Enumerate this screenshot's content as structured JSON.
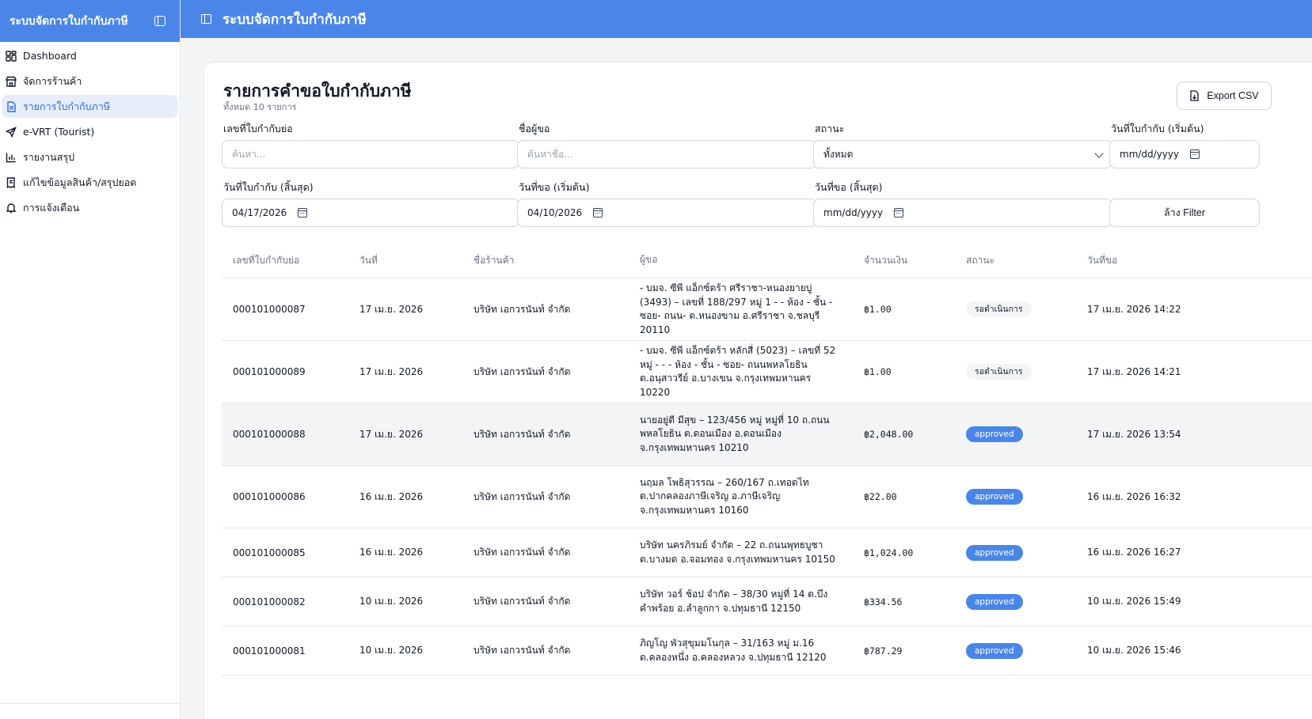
{
  "sidebar": {
    "title": "ระบบจัดการใบกำกับภาษี",
    "items": [
      {
        "label": "Dashboard",
        "icon": "dashboard-icon"
      },
      {
        "label": "จัดการร้านค้า",
        "icon": "store-icon"
      },
      {
        "label": "รายการใบกำกับภาษี",
        "icon": "document-icon",
        "active": true
      },
      {
        "label": "e-VRT (Tourist)",
        "icon": "plane-icon"
      },
      {
        "label": "รายงานสรุป",
        "icon": "bar-chart-icon"
      },
      {
        "label": "แก้ไขข้อมูลสินค้า/สรุปยอด",
        "icon": "receipt-edit-icon"
      },
      {
        "label": "การแจ้งเตือน",
        "icon": "bell-icon"
      }
    ]
  },
  "header": {
    "title": "ระบบจัดการใบกำกับภาษี"
  },
  "page": {
    "title": "รายการคำขอใบกำกับภาษี",
    "subtitle": "ทั้งหมด 10 รายการ",
    "export_label": "Export CSV"
  },
  "filters": {
    "invoice_no": {
      "label": "เลขที่ใบกำกับย่อ",
      "placeholder": "ค้นหา..."
    },
    "requester": {
      "label": "ชื่อผู้ขอ",
      "placeholder": "ค้นหาชื่อ..."
    },
    "status": {
      "label": "สถานะ",
      "value": "ทั้งหมด"
    },
    "invoice_date_start": {
      "label": "วันที่ใบกำกับ (เริ่มต้น)",
      "value": "mm/dd/yyyy"
    },
    "invoice_date_end": {
      "label": "วันที่ใบกำกับ (สิ้นสุด)",
      "value": "04/17/2026"
    },
    "request_date_start": {
      "label": "วันที่ขอ (เริ่มต้น)",
      "value": "04/10/2026"
    },
    "request_date_end": {
      "label": "วันที่ขอ (สิ้นสุด)",
      "value": "mm/dd/yyyy"
    },
    "clear_label": "ล้าง Filter"
  },
  "table": {
    "columns": [
      "เลขที่ใบกำกับย่อ",
      "วันที่",
      "ชื่อร้านค้า",
      "ผู้ขอ",
      "จำนวนเงิน",
      "สถานะ",
      "วันที่ขอ"
    ],
    "rows": [
      {
        "no": "000101000087",
        "date": "17 เม.ย. 2026",
        "shop": "บริษัท เอกวรนันท์ จำกัด",
        "requester": "- บมจ. ซีพี แอ็กซ์ตร้า ศรีราชา-หนองยายบู่ (3493) – เลขที่ 188/297 หมู่ 1 - - ห้อง - ชั้น - ซอย- ถนน- ต.หนองขาม อ.ศรีราชา จ.ชลบุรี 20110",
        "amount": "฿1.00",
        "status": "รอดำเนินการ",
        "status_type": "pending",
        "requested": "17 เม.ย. 2026 14:22"
      },
      {
        "no": "000101000089",
        "date": "17 เม.ย. 2026",
        "shop": "บริษัท เอกวรนันท์ จำกัด",
        "requester": "- บมจ. ซีพี แอ็กซ์ตร้า หลักสี่ (5023) – เลขที่ 52 หมู่ - - - ห้อง - ชั้น - ซอย- ถนนพหลโยธิน ต.อนุสาวรีย์ อ.บางเขน จ.กรุงเทพมหานคร 10220",
        "amount": "฿1.00",
        "status": "รอดำเนินการ",
        "status_type": "pending",
        "requested": "17 เม.ย. 2026 14:21"
      },
      {
        "no": "000101000088",
        "date": "17 เม.ย. 2026",
        "shop": "บริษัท เอกวรนันท์ จำกัด",
        "requester": "นายอยู่ดี มีสุข – 123/456 หมู่ หมู่ที่ 10 ถ.ถนนพหลโยธิน ต.ดอนเมือง อ.ดอนเมือง จ.กรุงเทพมหานคร 10210",
        "amount": "฿2,048.00",
        "status": "approved",
        "status_type": "approved",
        "requested": "17 เม.ย. 2026 13:54"
      },
      {
        "no": "000101000086",
        "date": "16 เม.ย. 2026",
        "shop": "บริษัท เอกวรนันท์ จำกัด",
        "requester": "นฤมล โพธิสุวรรณ – 260/167 ถ.เทอดไท ต.ปากคลองภาษีเจริญ อ.ภาษีเจริญ จ.กรุงเทพมหานคร 10160",
        "amount": "฿22.00",
        "status": "approved",
        "status_type": "approved",
        "requested": "16 เม.ย. 2026 16:32"
      },
      {
        "no": "000101000085",
        "date": "16 เม.ย. 2026",
        "shop": "บริษัท เอกวรนันท์ จำกัด",
        "requester": "บริษัท นครภิรมย์ จำกัด – 22 ถ.ถนนพุทธบูชา ต.บางมด อ.จอมทอง จ.กรุงเทพมหานคร 10150",
        "amount": "฿1,024.00",
        "status": "approved",
        "status_type": "approved",
        "requested": "16 เม.ย. 2026 16:27"
      },
      {
        "no": "000101000082",
        "date": "10 เม.ย. 2026",
        "shop": "บริษัท เอกวรนันท์ จำกัด",
        "requester": "บริษัท วอร์ ช้อป จำกัด – 38/30 หมู่ที่ 14 ต.บึงคำพร้อย อ.ลำลูกกา จ.ปทุมธานี 12150",
        "amount": "฿334.56",
        "status": "approved",
        "status_type": "approved",
        "requested": "10 เม.ย. 2026 15:49"
      },
      {
        "no": "000101000081",
        "date": "10 เม.ย. 2026",
        "shop": "บริษัท เอกวรนันท์ จำกัด",
        "requester": "ภิญโญ พัวสุขุมมโนกุล – 31/163 หมู่ ม.16 ต.คลองหนึ่ง อ.คลองหลวง จ.ปทุมธานี 12120",
        "amount": "฿787.29",
        "status": "approved",
        "status_type": "approved",
        "requested": "10 เม.ย. 2026 15:46"
      }
    ]
  }
}
